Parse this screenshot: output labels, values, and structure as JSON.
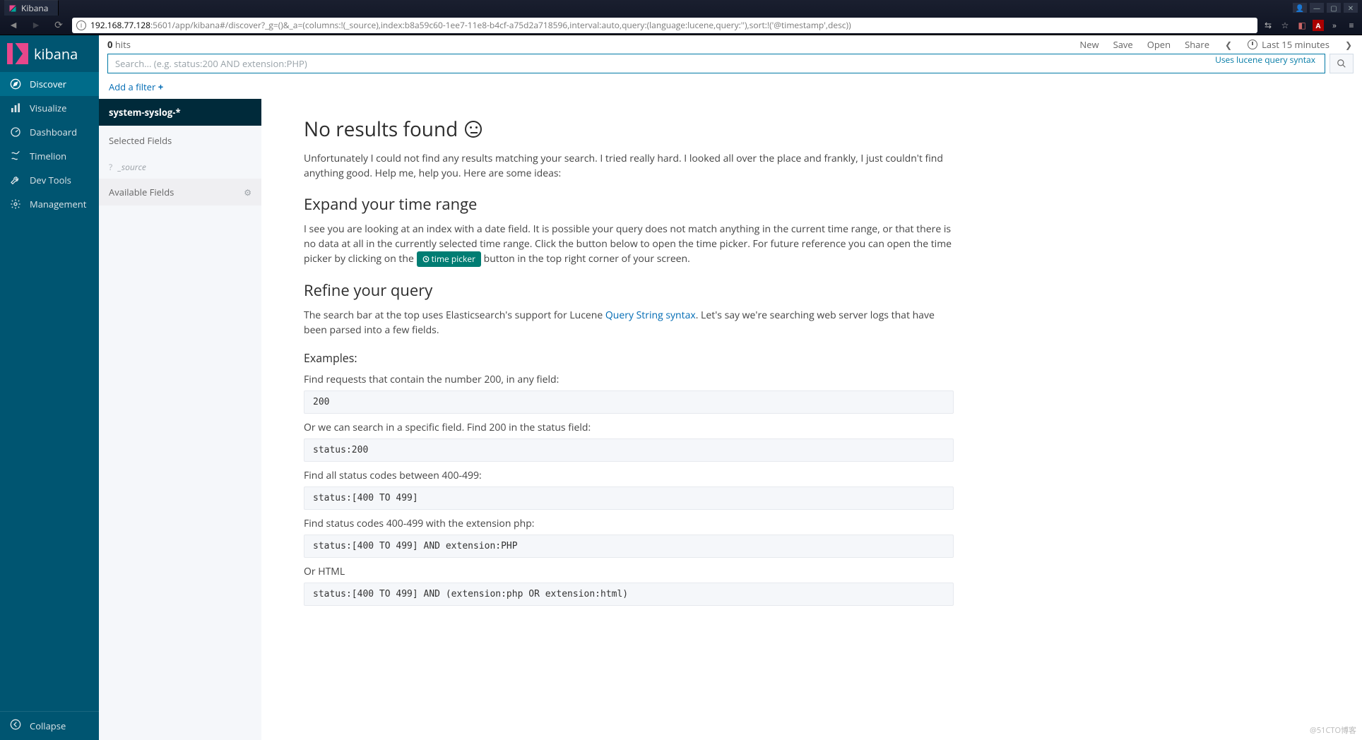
{
  "browser": {
    "tab_title": "Kibana",
    "url_host": "192.168.77.128",
    "url_path": ":5601/app/kibana#/discover?_g=()&_a=(columns:!(_source),index:b8a59c60-1ee7-11e8-b4cf-a75d2a718596,interval:auto,query:(language:lucene,query:''),sort:!('@timestamp',desc))"
  },
  "sidebar": {
    "brand": "kibana",
    "items": [
      {
        "label": "Discover"
      },
      {
        "label": "Visualize"
      },
      {
        "label": "Dashboard"
      },
      {
        "label": "Timelion"
      },
      {
        "label": "Dev Tools"
      },
      {
        "label": "Management"
      }
    ],
    "collapse": "Collapse"
  },
  "topbar": {
    "hits_count": "0",
    "hits_label": "hits",
    "actions": {
      "new": "New",
      "save": "Save",
      "open": "Open",
      "share": "Share"
    },
    "time_range": "Last 15 minutes"
  },
  "search": {
    "placeholder": "Search... (e.g. status:200 AND extension:PHP)",
    "hint": "Uses lucene query syntax"
  },
  "filters": {
    "add_label": "Add a filter"
  },
  "fields_pane": {
    "index_pattern": "system-syslog-*",
    "selected_header": "Selected Fields",
    "source_field": "_source",
    "available_header": "Available Fields"
  },
  "results": {
    "title": "No results found",
    "intro": "Unfortunately I could not find any results matching your search. I tried really hard. I looked all over the place and frankly, I just couldn't find anything good. Help me, help you. Here are some ideas:",
    "expand_header": "Expand your time range",
    "expand_body_pre": "I see you are looking at an index with a date field. It is possible your query does not match anything in the current time range, or that there is no data at all in the currently selected time range. Click the button below to open the time picker. For future reference you can open the time picker by clicking on the ",
    "time_picker_badge": "time picker",
    "expand_body_post": " button in the top right corner of your screen.",
    "refine_header": "Refine your query",
    "refine_body_pre": "The search bar at the top uses Elasticsearch's support for Lucene ",
    "refine_link": "Query String syntax",
    "refine_body_post": ". Let's say we're searching web server logs that have been parsed into a few fields.",
    "examples_header": "Examples:",
    "examples": [
      {
        "label": "Find requests that contain the number 200, in any field:",
        "code": "200"
      },
      {
        "label": "Or we can search in a specific field. Find 200 in the status field:",
        "code": "status:200"
      },
      {
        "label": "Find all status codes between 400-499:",
        "code": "status:[400 TO 499]"
      },
      {
        "label": "Find status codes 400-499 with the extension php:",
        "code": "status:[400 TO 499] AND extension:PHP"
      },
      {
        "label": "Or HTML",
        "code": "status:[400 TO 499] AND (extension:php OR extension:html)"
      }
    ]
  },
  "watermark": "@51CTO博客"
}
